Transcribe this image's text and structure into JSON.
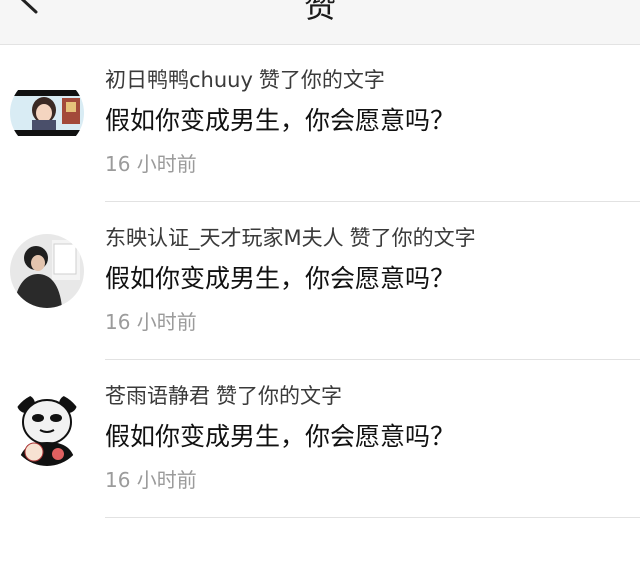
{
  "header": {
    "title": "赞",
    "back_icon": "chevron-left-icon"
  },
  "notifications": [
    {
      "user_name": "初日鸭鸭chuuy",
      "action": "赞了你的文字",
      "content": "假如你变成男生，你会愿意吗？",
      "time": "16 小时前",
      "avatar": "user-avatar-anime-girl"
    },
    {
      "user_name": "东映认证_天才玩家M夫人",
      "action": "赞了你的文字",
      "content": "假如你变成男生，你会愿意吗？",
      "time": "16 小时前",
      "avatar": "user-avatar-photo"
    },
    {
      "user_name": "苍雨语静君",
      "action": "赞了你的文字",
      "content": "假如你变成男生，你会愿意吗？",
      "time": "16 小时前",
      "avatar": "user-avatar-panda-meme"
    }
  ],
  "colors": {
    "header_bg": "#f6f6f6",
    "divider": "#e2e2e2",
    "primary_text": "#111111",
    "secondary_text": "#3a3a3a",
    "time_text": "#9b9b9b"
  }
}
